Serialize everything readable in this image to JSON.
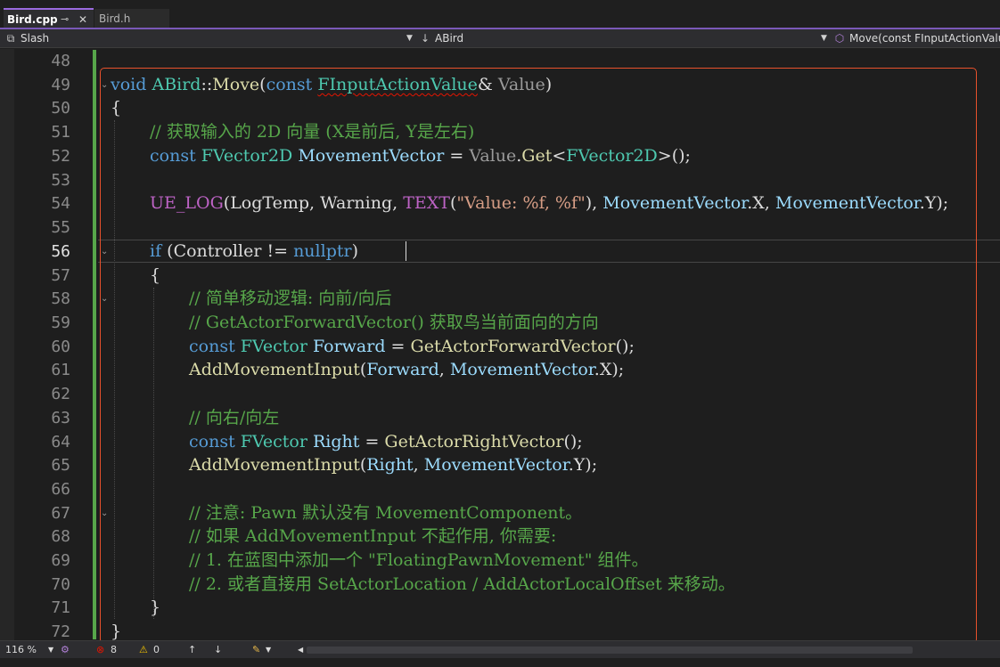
{
  "tabs": [
    {
      "label": "Bird.cpp",
      "pin_icon": "⊸",
      "close_icon": "✕"
    },
    {
      "label": "Bird.h"
    }
  ],
  "navbar": {
    "project": "Slash",
    "class": "ABird",
    "member": "Move(const FInputActionValu"
  },
  "editor": {
    "line_numbers": [
      "48",
      "49",
      "50",
      "51",
      "52",
      "53",
      "54",
      "55",
      "56",
      "57",
      "58",
      "59",
      "60",
      "61",
      "62",
      "63",
      "64",
      "65",
      "66",
      "67",
      "68",
      "69",
      "70",
      "71",
      "72"
    ],
    "current_line": "56",
    "lines": {
      "l49": {
        "kw": "void",
        "cls": "ABird",
        "sep": "::",
        "fn": "Move",
        "p1": "(",
        "kw2": "const",
        "ty": "FInputActionValue",
        "amp": "&",
        "param": "Value",
        "p2": ")"
      },
      "l50": {
        "text": "{"
      },
      "l51": {
        "comment": "// 获取输入的 2D 向量 (X是前后, Y是左右)"
      },
      "l52": {
        "kw": "const",
        "ty": "FVector2D",
        "var": "MovementVector",
        "eq": " = ",
        "param": "Value",
        "dot": ".",
        "fn": "Get",
        "lt": "<",
        "ty2": "FVector2D",
        "gt": ">",
        "end": "();"
      },
      "l54": {
        "mac": "UE_LOG",
        "p1": "(",
        "a1": "LogTemp",
        "c1": ", ",
        "a2": "Warning",
        "c2": ", ",
        "mac2": "TEXT",
        "p2": "(",
        "str": "\"Value: %f, %f\"",
        "p3": "), ",
        "v1": "MovementVector",
        "d1": ".X, ",
        "v2": "MovementVector",
        "d2": ".Y);"
      },
      "l56": {
        "kw": "if",
        "p1": " (",
        "id": "Controller",
        "op": " != ",
        "kw2": "nullptr",
        "p2": ")"
      },
      "l57": {
        "text": "{"
      },
      "l58": {
        "comment": "// 简单移动逻辑: 向前/向后"
      },
      "l59": {
        "comment": "// GetActorForwardVector() 获取鸟当前面向的方向"
      },
      "l60": {
        "kw": "const",
        "ty": "FVector",
        "var": "Forward",
        "eq": " = ",
        "fn": "GetActorForwardVector",
        "end": "();"
      },
      "l61": {
        "fn": "AddMovementInput",
        "p1": "(",
        "a1": "Forward",
        "c": ", ",
        "v": "MovementVector",
        "end": ".X);"
      },
      "l63": {
        "comment": "// 向右/向左"
      },
      "l64": {
        "kw": "const",
        "ty": "FVector",
        "var": "Right",
        "eq": " = ",
        "fn": "GetActorRightVector",
        "end": "();"
      },
      "l65": {
        "fn": "AddMovementInput",
        "p1": "(",
        "a1": "Right",
        "c": ", ",
        "v": "MovementVector",
        "end": ".Y);"
      },
      "l67": {
        "comment": "// 注意: Pawn 默认没有 MovementComponent。"
      },
      "l68": {
        "comment": "// 如果 AddMovementInput 不起作用, 你需要:"
      },
      "l69": {
        "comment": "// 1. 在蓝图中添加一个 \"FloatingPawnMovement\" 组件。"
      },
      "l70": {
        "comment": "// 2. 或者直接用 SetActorLocation / AddActorLocalOffset 来移动。"
      },
      "l71": {
        "text": "}"
      },
      "l72": {
        "text": "}"
      }
    }
  },
  "status": {
    "zoom": "116 %",
    "errors": "8",
    "warnings": "0"
  },
  "colors": {
    "keyword": "#569cd6",
    "type": "#4ec9b0",
    "function": "#dcdcaa",
    "variable": "#9cdcfe",
    "parameter": "#9a9a9a",
    "string": "#d69d85",
    "macro": "#bd63c5",
    "comment": "#57a64a",
    "highlight_box": "#e8512c",
    "error": "#e51400",
    "warning": "#f0c000"
  },
  "icons": {
    "project_icon": "⧉",
    "class_icon": "↓",
    "member_icon": "⬡",
    "dropdown_icon": "▼",
    "error_icon": "⊗",
    "warning_icon": "⚠",
    "up_icon": "↑",
    "down_icon": "↓",
    "brush_icon": "✎",
    "fold_icon": "⌄"
  }
}
